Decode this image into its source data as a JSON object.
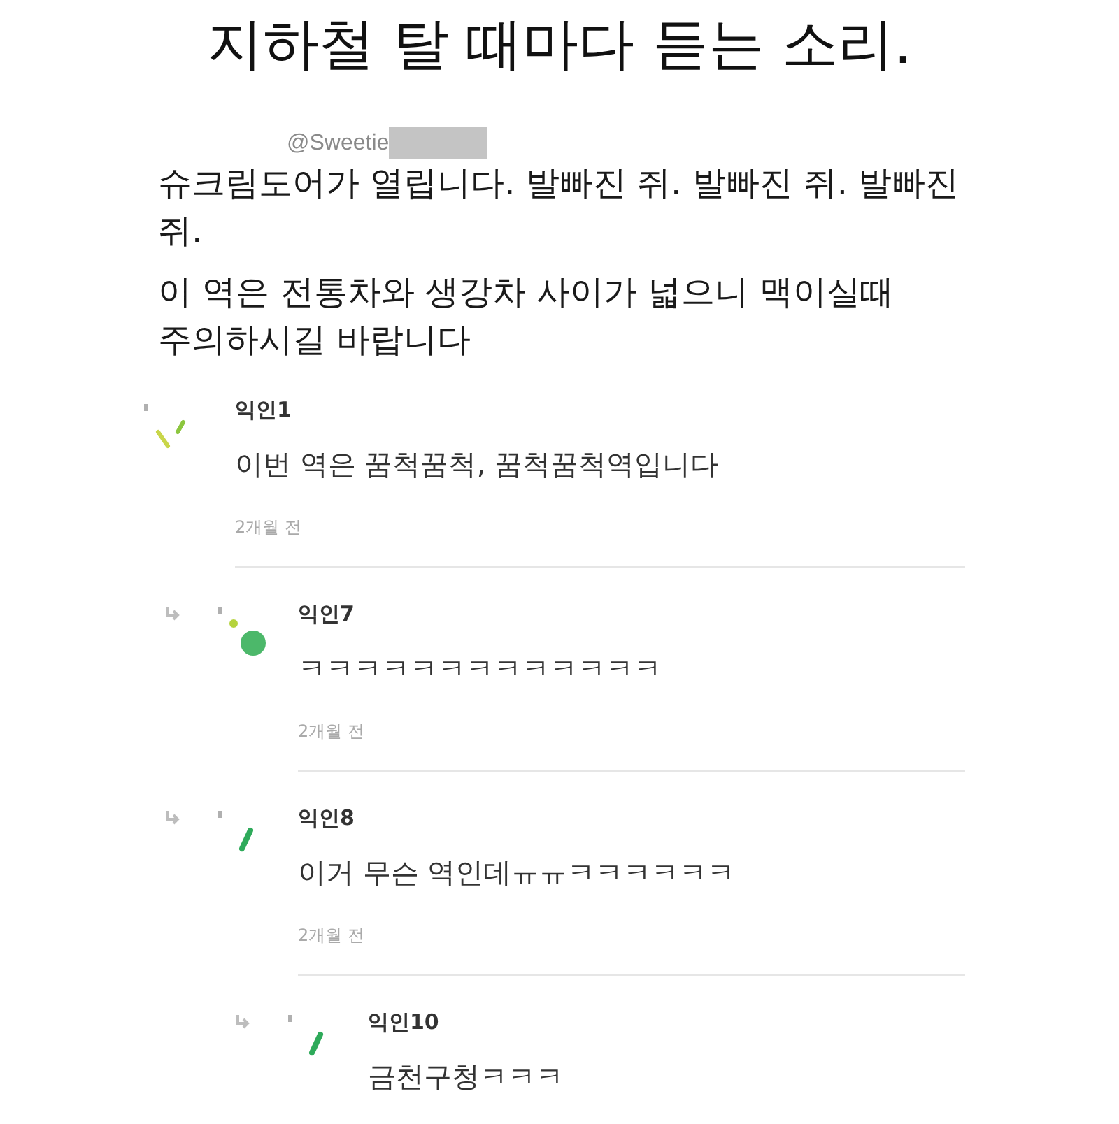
{
  "title": "지하철 탈 때마다 듣는 소리.",
  "tweet": {
    "handle": "@Sweetie",
    "paragraphs": [
      "슈크림도어가 열립니다. 발빠진 쥐. 발빠진 쥐. 발빠진 쥐.",
      "이 역은 전통차와 생강차 사이가 넓으니 맥이실때 주의하시길 바랍니다"
    ]
  },
  "comments": [
    {
      "author": "익인1",
      "text": "이번 역은 꿈척꿈척, 꿈척꿈척역입니다",
      "time": "2개월 전",
      "children": [
        {
          "author": "익인7",
          "text": "ㅋㅋㅋㅋㅋㅋㅋㅋㅋㅋㅋㅋㅋ",
          "time": "2개월 전"
        },
        {
          "author": "익인8",
          "text": "이거 무슨 역인데ㅠㅠㅋㅋㅋㅋㅋㅋ",
          "time": "2개월 전",
          "children": [
            {
              "author": "익인10",
              "text": "금천구청ㅋㅋㅋ"
            }
          ]
        }
      ]
    }
  ]
}
